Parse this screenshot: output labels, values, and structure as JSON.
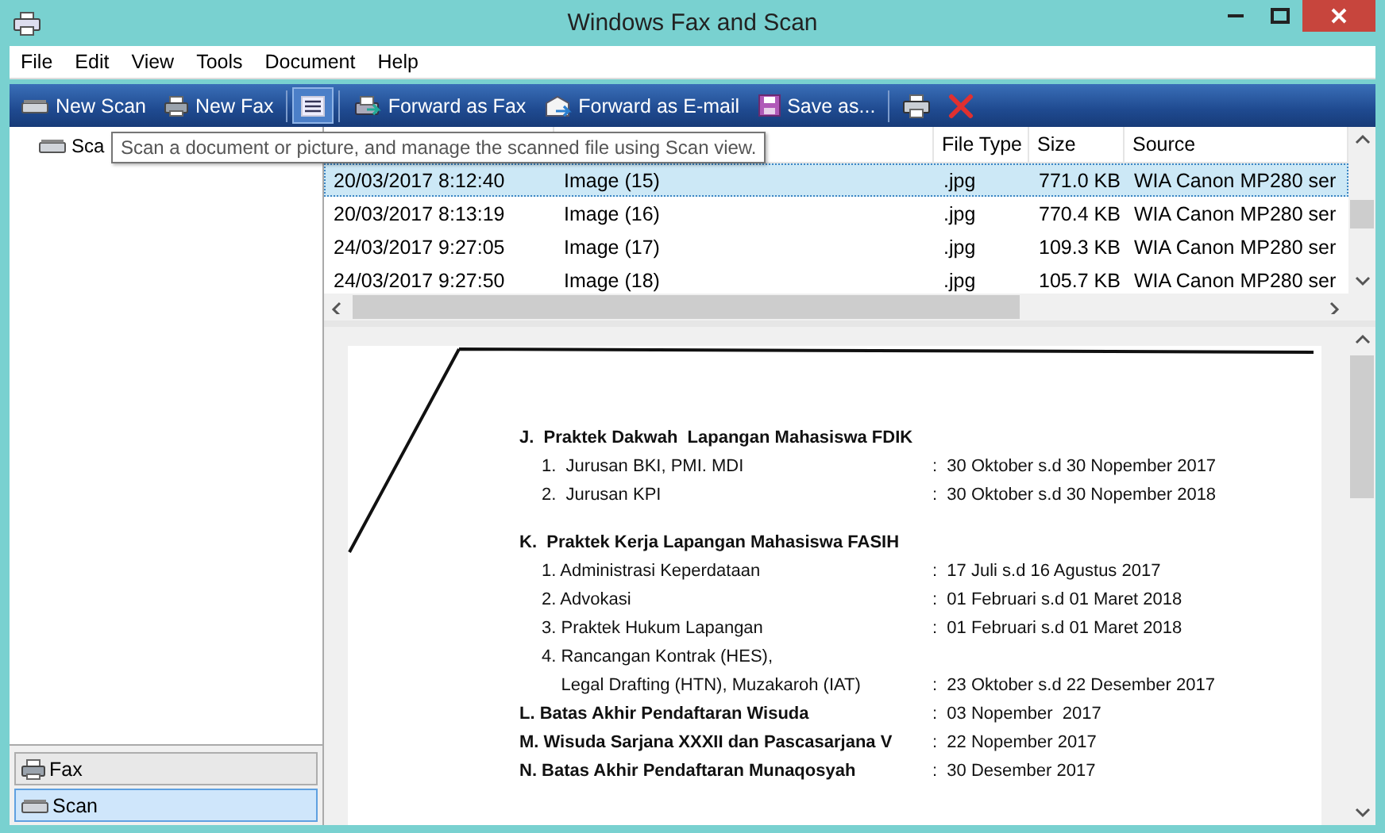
{
  "window": {
    "title": "Windows Fax and Scan"
  },
  "menu": [
    "File",
    "Edit",
    "View",
    "Tools",
    "Document",
    "Help"
  ],
  "toolbar": [
    {
      "kind": "scan",
      "label": "New Scan",
      "selected": false
    },
    {
      "kind": "fax",
      "label": "New Fax",
      "selected": false
    },
    {
      "kind": "view",
      "selected": true
    },
    {
      "kind": "forwardfax",
      "label": "Forward as Fax",
      "selected": false
    },
    {
      "kind": "email",
      "label": "Forward as E-mail",
      "selected": false
    },
    {
      "kind": "save",
      "label": "Save as...",
      "selected": false
    },
    {
      "kind": "print",
      "selected": false
    },
    {
      "kind": "delete",
      "selected": false
    }
  ],
  "tree": {
    "items": [
      {
        "label": "Sca"
      }
    ]
  },
  "tooltip": "Scan a document or picture, and manage the scanned file using Scan view.",
  "table": {
    "columns": [
      "",
      "",
      "File Type",
      "Size",
      "Source"
    ],
    "rows": [
      {
        "cells": [
          "20/03/2017 8:12:40",
          "Image (15)",
          ".jpg",
          "771.0 KB",
          "WIA Canon MP280 ser"
        ],
        "selected": true
      },
      {
        "cells": [
          "20/03/2017 8:13:19",
          "Image (16)",
          ".jpg",
          "770.4 KB",
          "WIA Canon MP280 ser"
        ],
        "selected": false
      },
      {
        "cells": [
          "24/03/2017 9:27:05",
          "Image (17)",
          ".jpg",
          "109.3 KB",
          "WIA Canon MP280 ser"
        ],
        "selected": false
      },
      {
        "cells": [
          "24/03/2017 9:27:50",
          "Image (18)",
          ".jpg",
          "105.7 KB",
          "WIA Canon MP280 ser"
        ],
        "selected": false
      }
    ]
  },
  "document": {
    "lines": [
      {
        "kind": "heading",
        "text": "J.  Praktek Dakwah  Lapangan Mahasiswa FDIK"
      },
      {
        "kind": "item",
        "text": "1.  Jurusan BKI, PMI. MDI",
        "date": ":  30 Oktober s.d 30 Nopember 2017"
      },
      {
        "kind": "item",
        "text": "2.  Jurusan KPI",
        "date": ":  30 Oktober s.d 30 Nopember 2018"
      },
      {
        "kind": "gap"
      },
      {
        "kind": "heading",
        "text": "K.  Praktek Kerja Lapangan Mahasiswa FASIH"
      },
      {
        "kind": "item",
        "text": "1. Administrasi Keperdataan",
        "date": ":  17 Juli s.d 16 Agustus 2017"
      },
      {
        "kind": "item",
        "text": "2. Advokasi",
        "date": ":  01 Februari s.d 01 Maret 2018"
      },
      {
        "kind": "item",
        "text": "3. Praktek Hukum Lapangan",
        "date": ":  01 Februari s.d 01 Maret 2018"
      },
      {
        "kind": "item",
        "text": "4. Rancangan Kontrak (HES),"
      },
      {
        "kind": "item",
        "text": "    Legal Drafting (HTN), Muzakaroh (IAT)",
        "date": ":  23 Oktober s.d 22 Desember 2017"
      },
      {
        "kind": "heading",
        "text": "L. Batas Akhir Pendaftaran Wisuda",
        "date": ":  03 Nopember  2017"
      },
      {
        "kind": "heading",
        "text": "M. Wisuda Sarjana XXXII dan Pascasarjana V",
        "date": ":  22 Nopember 2017"
      },
      {
        "kind": "heading",
        "text": "N. Batas Akhir Pendaftaran Munaqosyah",
        "date": ":  30 Desember 2017"
      }
    ]
  },
  "nav": [
    {
      "kind": "fax",
      "label": "Fax",
      "selected": false
    },
    {
      "kind": "scan",
      "label": "Scan",
      "selected": true
    }
  ]
}
